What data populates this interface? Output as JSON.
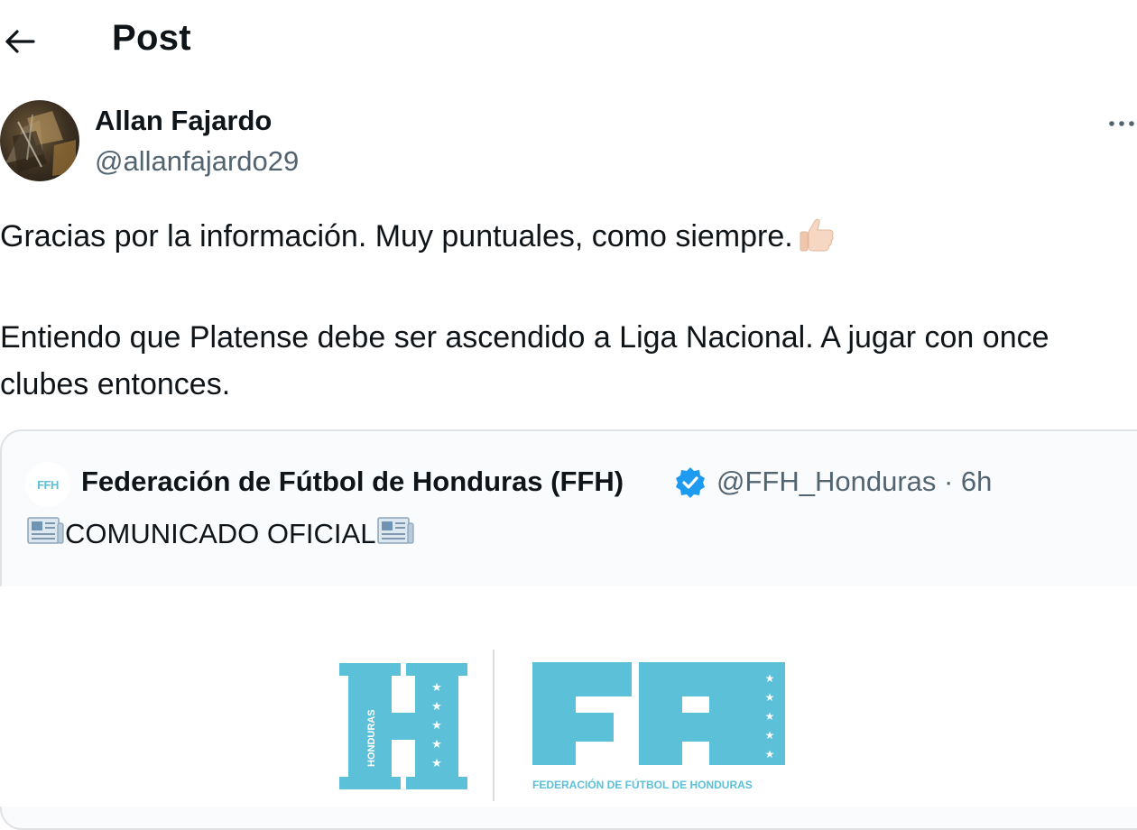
{
  "header": {
    "title": "Post"
  },
  "post": {
    "author_name": "Allan Fajardo",
    "author_handle": "@allanfajardo29",
    "text_line1": "Gracias por la información. Muy puntuales, como siempre.",
    "text_line2": "Entiendo que Platense debe ser ascendido a Liga Nacional. A jugar con once clubes entonces."
  },
  "quote": {
    "avatar_text": "FFH",
    "name": "Federación de Fútbol de Honduras (FFH)",
    "handle_time": "@FFH_Honduras · 6h",
    "text": "COMUNICADO OFICIAL"
  },
  "media": {
    "logo_text": "FFH",
    "h_vertical_text": "HONDURAS",
    "tagline": "FEDERACIÓN DE FÚTBOL DE HONDURAS"
  },
  "colors": {
    "brand": "#5bc0d8",
    "verified": "#1d9bf0",
    "text": "#0f1419",
    "muted": "#536471"
  }
}
